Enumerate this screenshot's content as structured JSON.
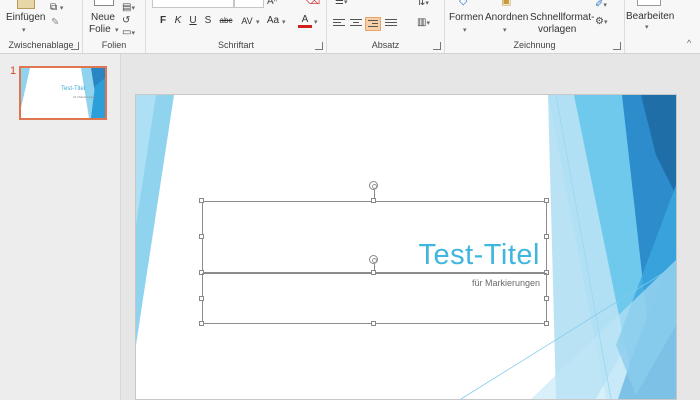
{
  "ribbon": {
    "clipboard": {
      "paste_label": "Einfügen",
      "group_label": "Zwischenablage"
    },
    "slides": {
      "new_slide_line1": "Neue",
      "new_slide_line2": "Folie",
      "group_label": "Folien"
    },
    "font": {
      "bold": "F",
      "italic": "K",
      "underline": "U",
      "shadow": "S",
      "strike": "abc",
      "spacing": "AV",
      "change_case": "Aa",
      "font_color": "A",
      "group_label": "Schriftart"
    },
    "paragraph": {
      "group_label": "Absatz"
    },
    "drawing": {
      "shapes_label": "Formen",
      "arrange_label": "Anordnen",
      "quick_styles_line1": "Schnellformat-",
      "quick_styles_line2": "vorlagen",
      "group_label": "Zeichnung"
    },
    "editing": {
      "label": "Bearbeiten"
    }
  },
  "thumbnails": [
    {
      "number": "1",
      "title": "Test-Titel",
      "subtitle": "für Markierungen"
    }
  ],
  "slide": {
    "title": "Test-Titel",
    "subtitle": "für Markierungen"
  },
  "colors": {
    "accent": "#3fb6de",
    "selection_border": "#e07650",
    "ribbon_bg": "#f7f7f7"
  }
}
